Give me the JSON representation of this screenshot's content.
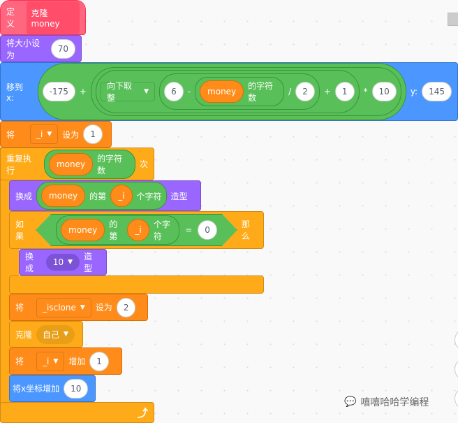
{
  "define": {
    "label": "定义",
    "name": "克隆money"
  },
  "set_size": {
    "label": "将大小设为",
    "value": "70"
  },
  "goto": {
    "label": "移到 x:",
    "x": "-175",
    "plus": "+",
    "floor": "向下取整",
    "six": "6",
    "minus": "-",
    "var": "money",
    "len": "的字符数",
    "div": "/",
    "two": "2",
    "plus2": "+",
    "one": "1",
    "mul": "*",
    "ten": "10",
    "ylabel": "y:",
    "y": "145"
  },
  "set_i": {
    "label": "将",
    "var": "_i",
    "to": "设为",
    "value": "1"
  },
  "repeat": {
    "label": "重复执行",
    "var": "money",
    "len": "的字符数",
    "times": "次"
  },
  "switch1": {
    "label": "换成",
    "var": "money",
    "of": "的第",
    "idx": "_i",
    "char": "个字符",
    "costume": "造型"
  },
  "if": {
    "label": "如果",
    "var": "money",
    "of": "的第",
    "idx": "_i",
    "char": "个字符",
    "eq": "=",
    "value": "0",
    "then": "那么"
  },
  "switch2": {
    "label": "换成",
    "value": "10",
    "costume": "造型"
  },
  "set_clone": {
    "label": "将",
    "var": "_isclone",
    "to": "设为",
    "value": "2"
  },
  "clone": {
    "label": "克隆",
    "target": "自己"
  },
  "change_i": {
    "label": "将",
    "var": "_i",
    "by": "增加",
    "value": "1"
  },
  "change_x": {
    "label": "将x坐标增加",
    "value": "10"
  },
  "watermark": "嘻嘻哈哈学编程",
  "colors": {
    "events": "#FF6680",
    "looks": "#9966FF",
    "motion": "#4C97FF",
    "variables": "#FF8C1A",
    "control": "#FFAB19",
    "operators": "#59C059"
  }
}
